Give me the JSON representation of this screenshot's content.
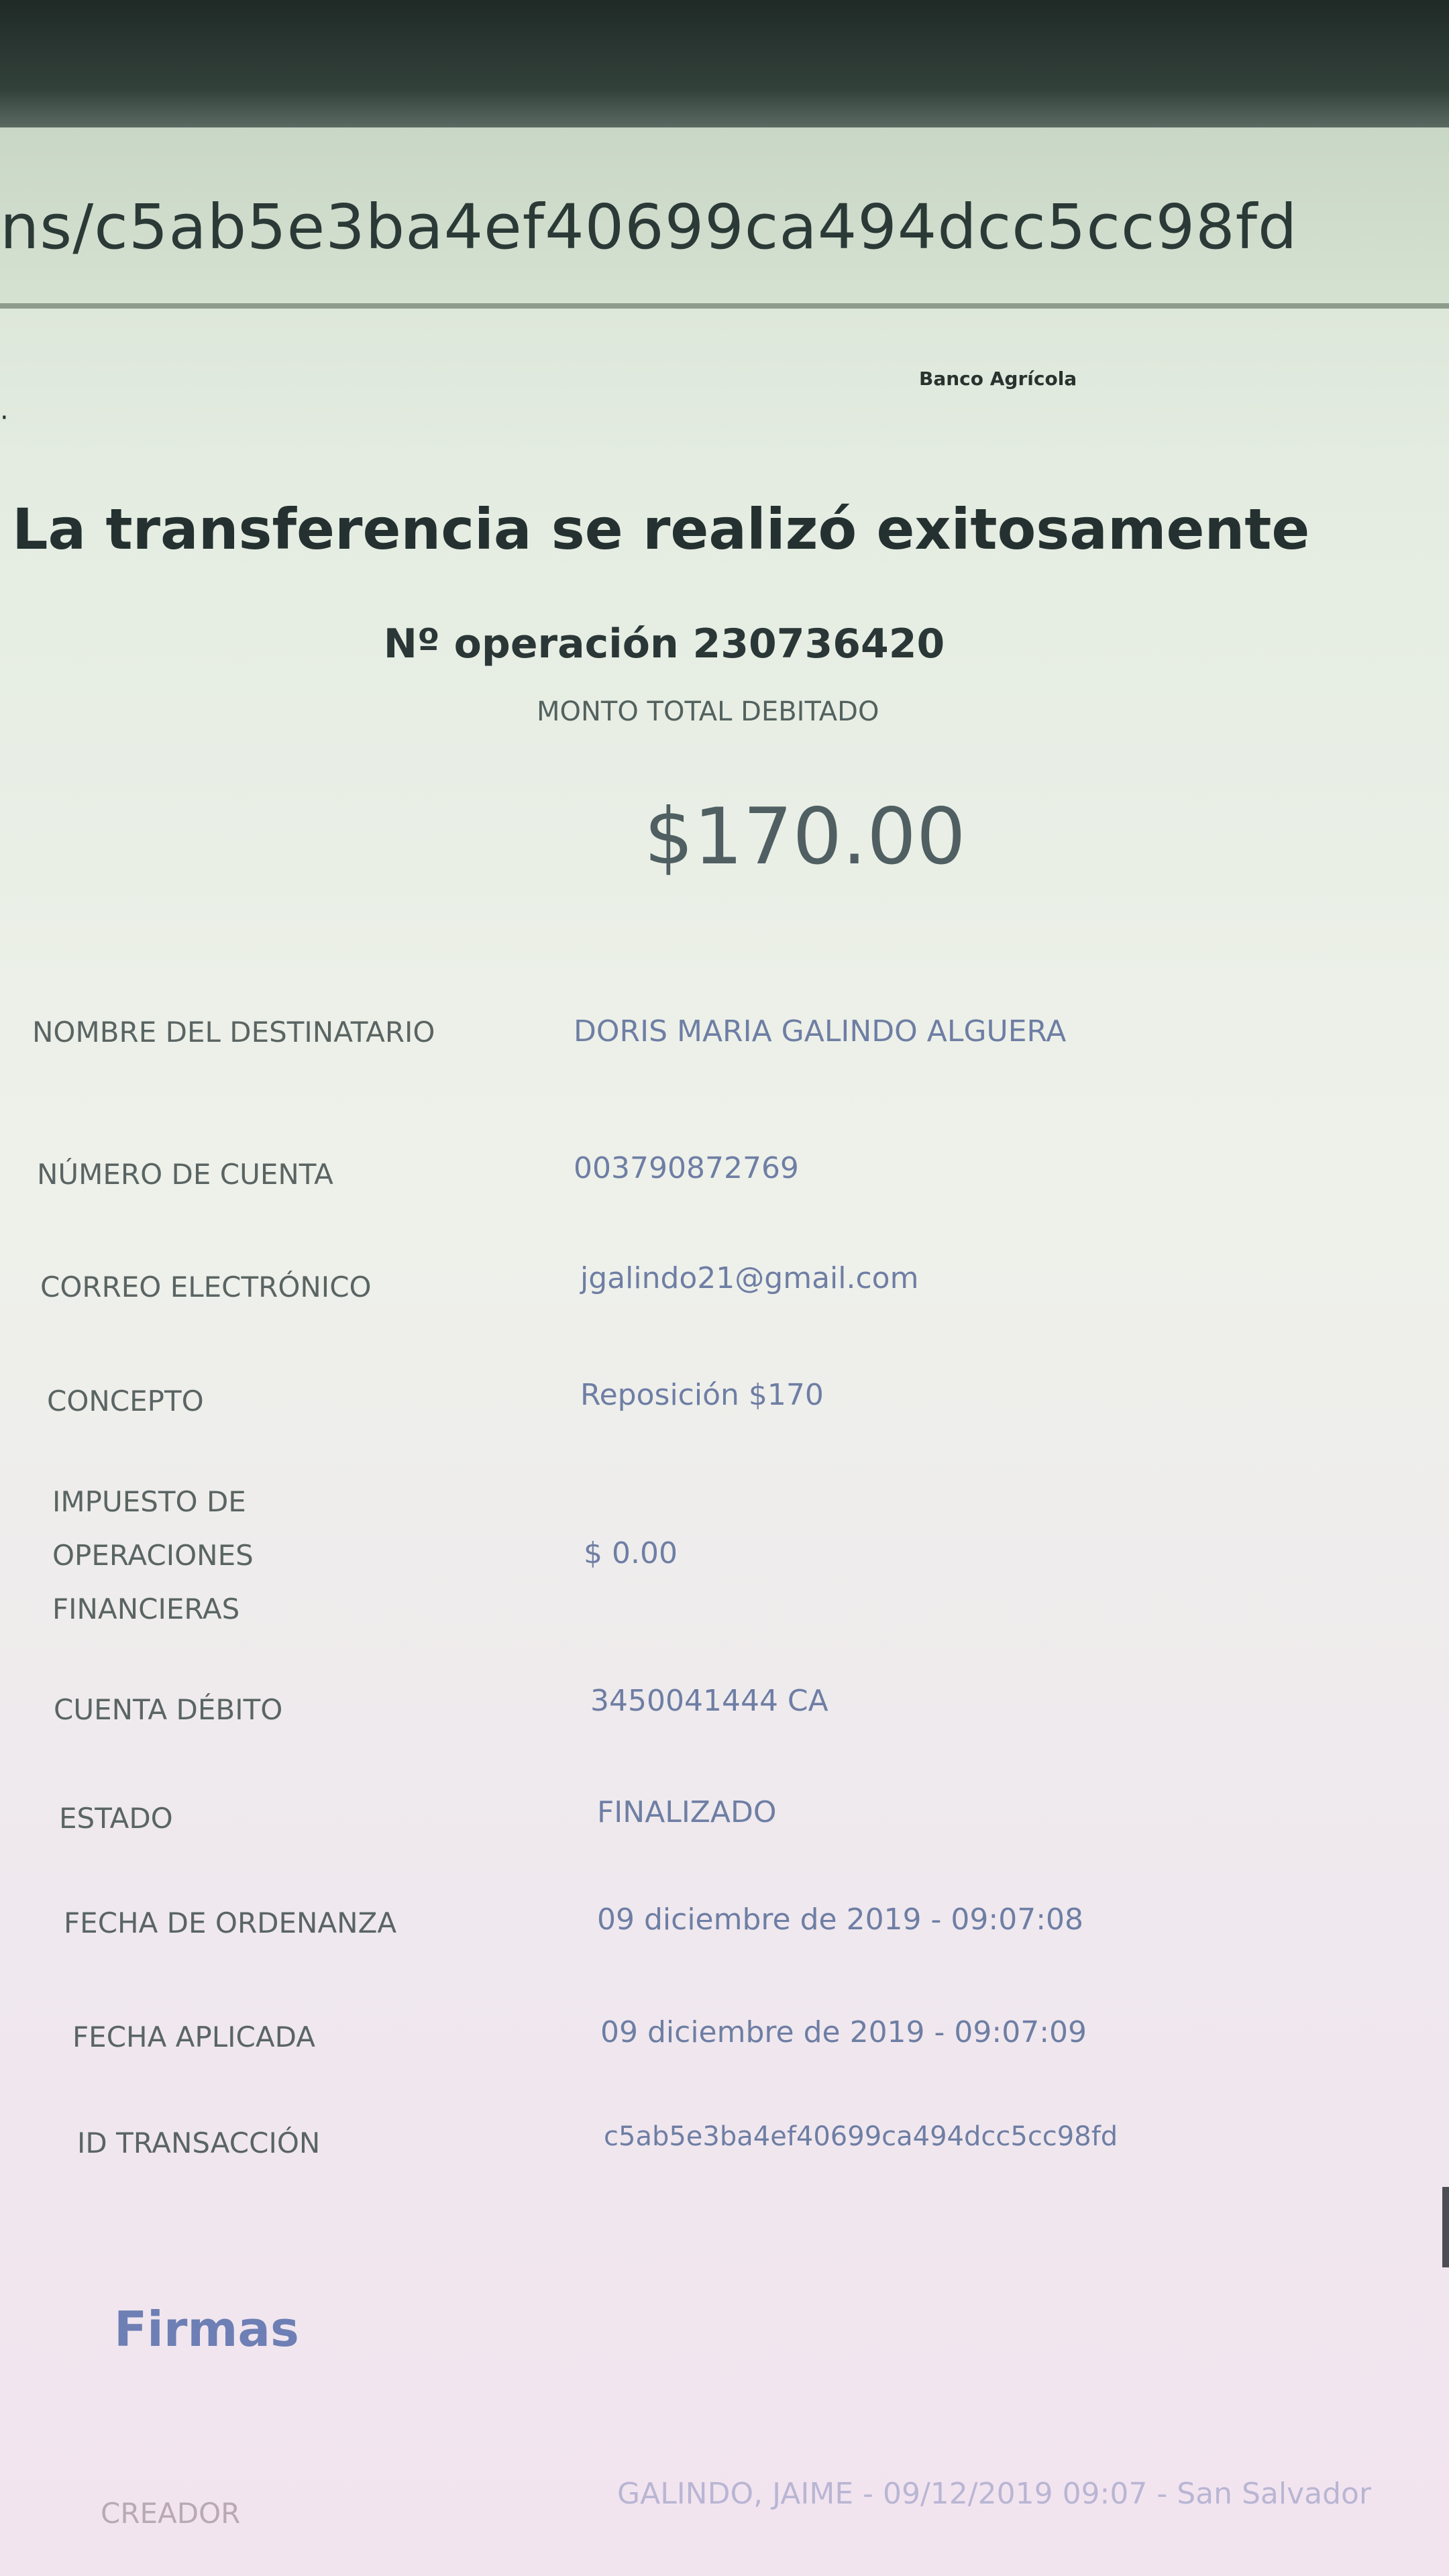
{
  "browser": {
    "url_fragment": "ns/c5ab5e3ba4ef40699ca494dcc5cc98fd"
  },
  "header": {
    "menu_glyph": "·",
    "bank_name": "Banco Agrícola"
  },
  "receipt": {
    "headline": "La transferencia se realizó exitosamente",
    "operation": "Nº operación 230736420",
    "amount_label": "MONTO TOTAL DEBITADO",
    "amount": "$170.00",
    "details": [
      {
        "label": "NOMBRE DEL DESTINATARIO",
        "value": "DORIS MARIA GALINDO ALGUERA"
      },
      {
        "label": "NÚMERO DE CUENTA",
        "value": "003790872769"
      },
      {
        "label": "CORREO ELECTRÓNICO",
        "value": "jgalindo21@gmail.com"
      },
      {
        "label": "CONCEPTO",
        "value": "Reposición $170"
      },
      {
        "label": "IMPUESTO DE OPERACIONES FINANCIERAS",
        "label_lines": [
          "IMPUESTO DE",
          "OPERACIONES",
          "FINANCIERAS"
        ],
        "value": "$ 0.00"
      },
      {
        "label": "CUENTA DÉBITO",
        "value": "3450041444 CA"
      },
      {
        "label": "ESTADO",
        "value": "FINALIZADO"
      },
      {
        "label": "FECHA DE ORDENANZA",
        "value": "09 diciembre de 2019 - 09:07:08"
      },
      {
        "label": "FECHA APLICADA",
        "value": "09 diciembre de 2019 - 09:07:09"
      },
      {
        "label": "ID TRANSACCIÓN",
        "value": "c5ab5e3ba4ef40699ca494dcc5cc98fd"
      }
    ]
  },
  "signatures": {
    "title": "Firmas",
    "rows": [
      {
        "label": "CREADOR",
        "value": "GALINDO, JAIME - 09/12/2019 09:07 - San Salvador"
      }
    ]
  }
}
